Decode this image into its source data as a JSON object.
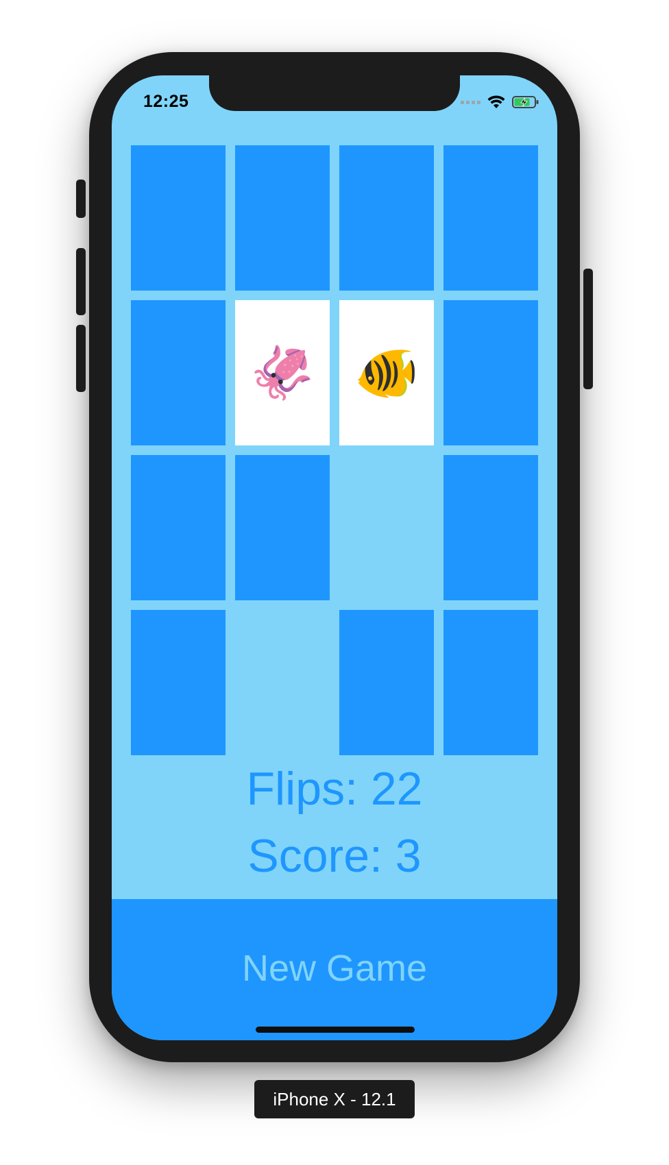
{
  "status_bar": {
    "time": "12:25",
    "signal_icon": "cellular-signal-icon",
    "wifi_icon": "wifi-icon",
    "battery_icon": "battery-charging-icon"
  },
  "game": {
    "cards": [
      {
        "state": "face-down",
        "emoji": ""
      },
      {
        "state": "face-down",
        "emoji": ""
      },
      {
        "state": "face-down",
        "emoji": ""
      },
      {
        "state": "face-down",
        "emoji": ""
      },
      {
        "state": "face-down",
        "emoji": ""
      },
      {
        "state": "face-up",
        "emoji": "🦑"
      },
      {
        "state": "face-up",
        "emoji": "🐠"
      },
      {
        "state": "face-down",
        "emoji": ""
      },
      {
        "state": "face-down",
        "emoji": ""
      },
      {
        "state": "face-down",
        "emoji": ""
      },
      {
        "state": "matched",
        "emoji": ""
      },
      {
        "state": "face-down",
        "emoji": ""
      },
      {
        "state": "face-down",
        "emoji": ""
      },
      {
        "state": "matched",
        "emoji": ""
      },
      {
        "state": "face-down",
        "emoji": ""
      },
      {
        "state": "face-down",
        "emoji": ""
      }
    ],
    "flips_label": "Flips: 22",
    "score_label": "Score: 3",
    "new_game_label": "New Game"
  },
  "simulator": {
    "device_label": "iPhone X - 12.1"
  },
  "colors": {
    "background": "#80d4f9",
    "card_back": "#1e96fe",
    "card_face": "#ffffff",
    "text_accent": "#1e96fe"
  }
}
